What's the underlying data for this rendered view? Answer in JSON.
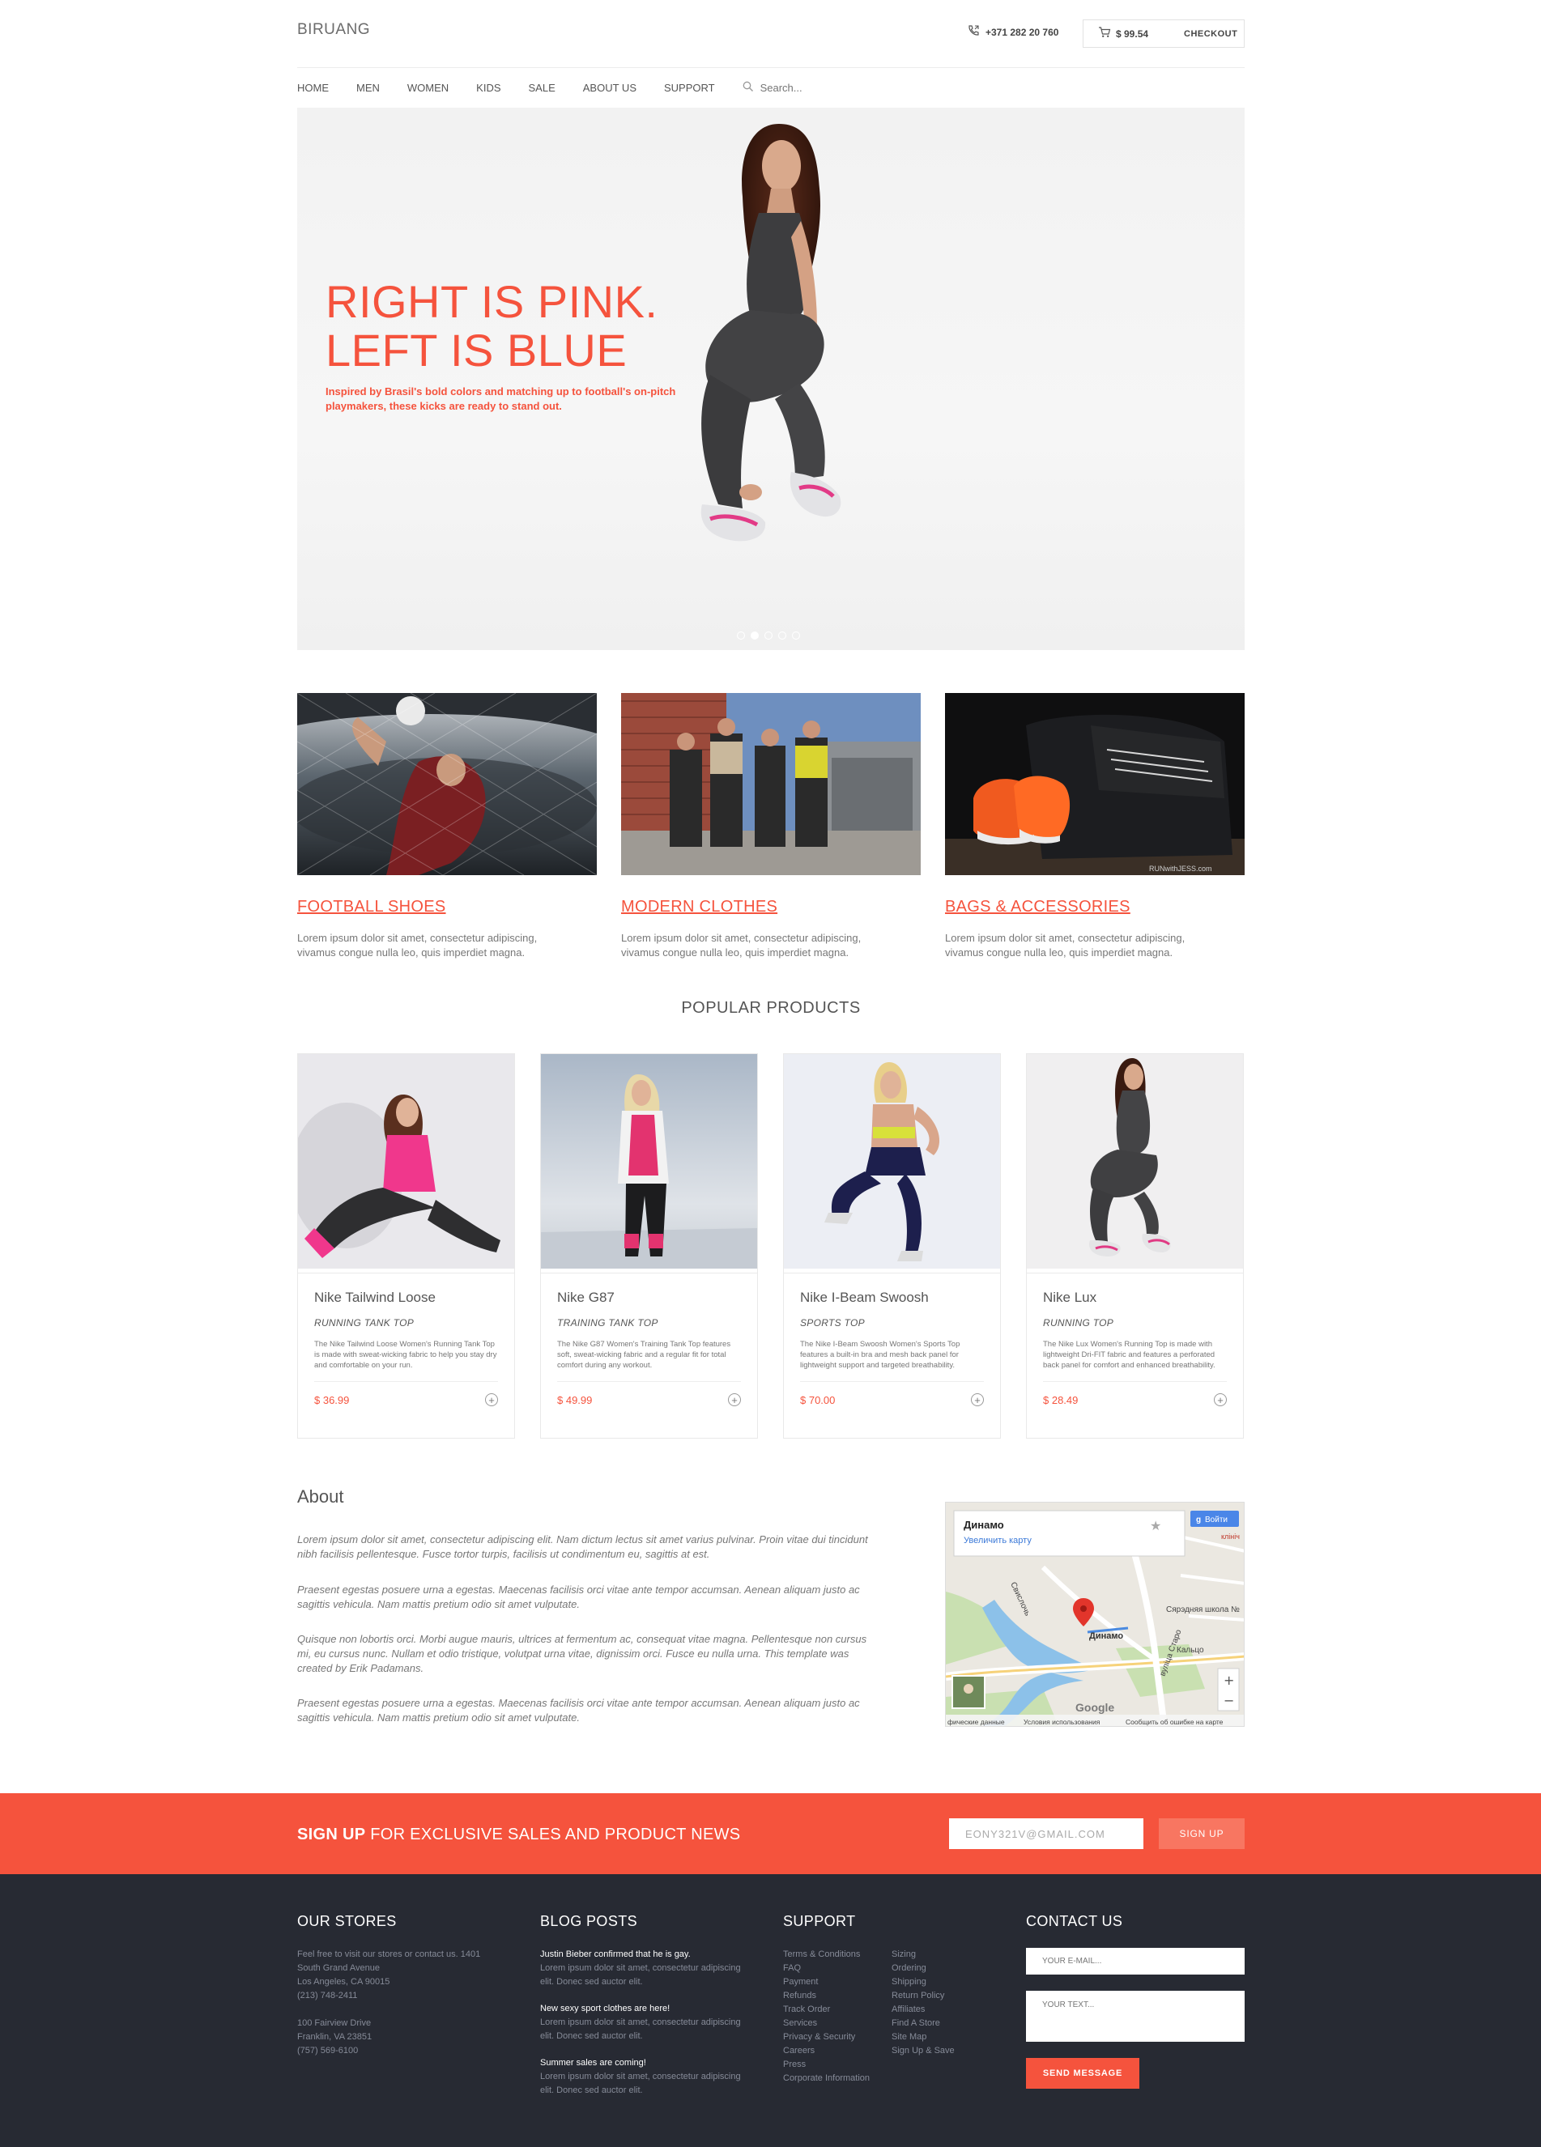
{
  "header": {
    "logo": "BIRUANG",
    "phone": "+371 282 20 760",
    "cart_total": "$ 99.54",
    "checkout_label": "CHECKOUT"
  },
  "nav": {
    "items": [
      "HOME",
      "MEN",
      "WOMEN",
      "KIDS",
      "SALE",
      "ABOUT US",
      "SUPPORT"
    ],
    "search_placeholder": "Search..."
  },
  "hero": {
    "title_line1": "RIGHT IS PINK.",
    "title_line2": "LEFT IS BLUE",
    "subtitle": "Inspired by Brasil's bold colors and matching up to football's on-pitch playmakers, these kicks are ready to stand out.",
    "slide_count": 5,
    "active_slide": 2
  },
  "categories": [
    {
      "title": "FOOTBALL SHOES",
      "text": "Lorem ipsum dolor sit amet, consectetur adipiscing, vivamus congue nulla leo, quis imperdiet magna."
    },
    {
      "title": "MODERN CLOTHES",
      "text": "Lorem ipsum dolor sit amet, consectetur adipiscing, vivamus congue nulla leo, quis imperdiet magna."
    },
    {
      "title": "BAGS & ACCESSORIES",
      "text": "Lorem ipsum dolor sit amet, consectetur adipiscing, vivamus congue nulla leo, quis imperdiet magna.",
      "watermark": "RUNwithJESS.com"
    }
  ],
  "popular": {
    "title": "POPULAR PRODUCTS",
    "products": [
      {
        "name": "Nike Tailwind Loose",
        "type": "RUNNING TANK TOP",
        "desc": "The Nike Tailwind Loose Women's Running Tank Top is made with sweat-wicking fabric to help you stay dry and comfortable on your run.",
        "price": "$ 36.99"
      },
      {
        "name": "Nike G87",
        "type": "TRAINING TANK TOP",
        "desc": "The Nike G87 Women's Training Tank Top features soft, sweat-wicking fabric and a regular fit for total comfort during any workout.",
        "price": "$ 49.99"
      },
      {
        "name": "Nike I-Beam Swoosh",
        "type": "SPORTS TOP",
        "desc": "The Nike I-Beam Swoosh Women's Sports Top features a built-in bra and mesh back panel for lightweight support and targeted breathability.",
        "price": "$ 70.00"
      },
      {
        "name": "Nike Lux",
        "type": "RUNNING TOP",
        "desc": "The Nike Lux Women's Running Top is made with lightweight Dri-FIT fabric and features a perforated back panel for comfort and enhanced breathability.",
        "price": "$ 28.49"
      }
    ]
  },
  "about": {
    "title": "About",
    "paragraphs": [
      "Lorem ipsum dolor sit amet, consectetur adipiscing elit. Nam dictum lectus sit amet varius pulvinar. Proin vitae dui tincidunt nibh facilisis pellentesque. Fusce tortor turpis, facilisis ut condimentum eu, sagittis at est.",
      "Praesent egestas posuere urna a egestas. Maecenas facilisis orci vitae ante tempor accumsan. Aenean aliquam justo ac sagittis vehicula. Nam mattis pretium odio sit amet vulputate.",
      "Quisque non lobortis orci. Morbi augue mauris, ultrices at fermentum ac, consequat vitae magna. Pellentesque non cursus mi, eu cursus nunc. Nullam et odio tristique, volutpat urna vitae, dignissim orci. Fusce eu nulla urna. This template was created by Erik Padamans.",
      "Praesent egestas posuere urna a egestas. Maecenas facilisis orci vitae ante tempor accumsan. Aenean aliquam justo ac sagittis vehicula. Nam mattis pretium odio sit amet vulputate."
    ]
  },
  "map": {
    "place_name": "Динамо",
    "enlarge_link": "Увеличить карту",
    "signin": "Войти",
    "marker_label": "Динамо",
    "labels": [
      "Сярэдняя школа №",
      "Кальцо",
      "вуліца Старо",
      "Свислочь",
      "клініч"
    ],
    "attribution": [
      "фические данные",
      "Условия использования",
      "Сообщить об ошибке на карте"
    ],
    "logo": "Google",
    "zoom_in": "+",
    "zoom_out": "−"
  },
  "signup": {
    "text_bold": "SIGN UP",
    "text_rest": " FOR EXCLUSIVE SALES AND PRODUCT NEWS",
    "email_value": "EONY321V@GMAIL.COM",
    "button": "SIGN UP"
  },
  "footer": {
    "stores": {
      "title": "OUR STORES",
      "intro": [
        "Feel free to visit our stores or contact us. 1401",
        "South Grand Avenue",
        "Los Angeles, CA 90015",
        "(213) 748-2411"
      ],
      "second": [
        "100 Fairview Drive",
        "Franklin, VA 23851",
        "(757) 569-6100"
      ]
    },
    "blog": {
      "title": "BLOG POSTS",
      "posts": [
        {
          "title": "Justin Bieber confirmed that he is gay.",
          "text": "Lorem ipsum dolor sit amet, consectetur adipiscing elit. Donec sed auctor elit."
        },
        {
          "title": "New sexy sport clothes are here!",
          "text": "Lorem ipsum dolor sit amet, consectetur adipiscing elit. Donec sed auctor elit."
        },
        {
          "title": "Summer sales are coming!",
          "text": "Lorem ipsum dolor sit amet, consectetur adipiscing elit. Donec sed auctor elit."
        }
      ]
    },
    "support": {
      "title": "SUPPORT",
      "col1": [
        "Terms & Conditions",
        "FAQ",
        "Payment",
        "Refunds",
        "Track Order",
        "Services",
        "Privacy & Security",
        "Careers",
        "Press",
        "Corporate Information"
      ],
      "col2": [
        "Sizing",
        "Ordering",
        "Shipping",
        "Return Policy",
        "Affiliates",
        "Find A Store",
        "Site Map",
        "Sign Up & Save"
      ]
    },
    "contact": {
      "title": "CONTACT US",
      "email_placeholder": "YOUR E-MAIL...",
      "text_placeholder": "YOUR TEXT...",
      "button": "SEND MESSAGE"
    }
  }
}
